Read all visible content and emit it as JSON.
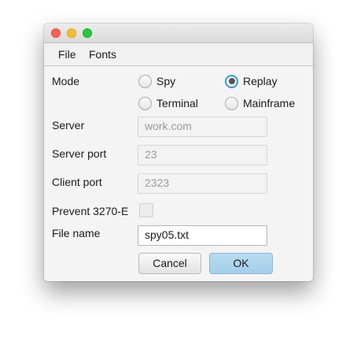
{
  "menu": {
    "file": "File",
    "fonts": "Fonts"
  },
  "form": {
    "mode_label": "Mode",
    "mode_options": [
      {
        "label": "Spy",
        "selected": false
      },
      {
        "label": "Replay",
        "selected": true
      },
      {
        "label": "Terminal",
        "selected": false
      },
      {
        "label": "Mainframe",
        "selected": false
      }
    ],
    "server_label": "Server",
    "server_value": "work.com",
    "server_port_label": "Server port",
    "server_port_value": "23",
    "client_port_label": "Client port",
    "client_port_value": "2323",
    "prevent_label": "Prevent 3270-E",
    "prevent_checked": false,
    "file_name_label": "File name",
    "file_name_value": "spy05.txt"
  },
  "buttons": {
    "cancel": "Cancel",
    "ok": "OK"
  },
  "colors": {
    "ok_button": "#a9d3ec",
    "radio_focus": "#3a9ad9"
  }
}
